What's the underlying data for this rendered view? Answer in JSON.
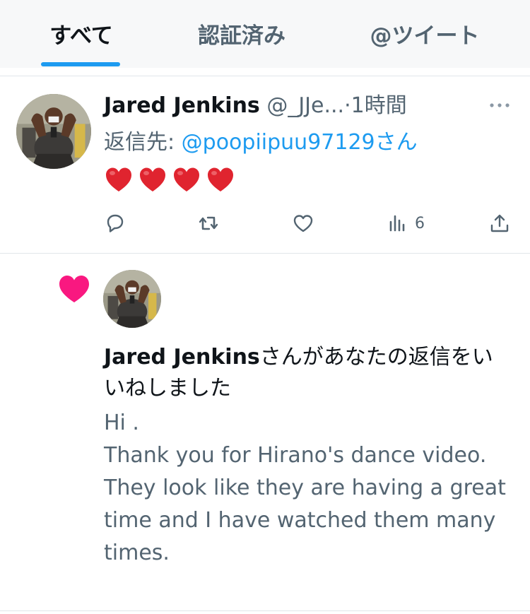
{
  "tabs": {
    "all": "すべて",
    "verified": "認証済み",
    "mentions": "@ツイート"
  },
  "tweet": {
    "display_name": "Jared Jenkins",
    "handle": "@_JJe...",
    "separator": "·",
    "time": "1時間",
    "reply_prefix": "返信先: ",
    "reply_handle": "@poopiipuu97129",
    "reply_suffix": "さん",
    "hearts": [
      "❤️",
      "❤️",
      "❤️",
      "❤️"
    ],
    "views": "6"
  },
  "notification": {
    "name": "Jared Jenkins",
    "action_text": "さんがあなたの返信をいいねしました",
    "body": [
      "Hi .",
      "Thank you for Hirano's dance video.",
      "They look like they are having a great time and I have watched them many times."
    ]
  },
  "colors": {
    "accent": "#1d9bf0",
    "like_pink": "#f91880",
    "heart_red": "#e0242f",
    "muted": "#536471"
  }
}
